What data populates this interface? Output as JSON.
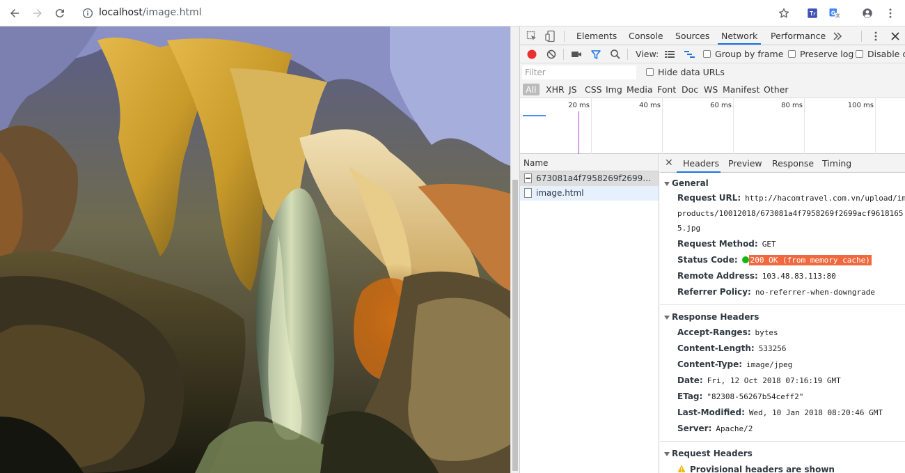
{
  "browser": {
    "url_host": "localhost",
    "url_path": "/image.html",
    "icons": [
      "back-icon",
      "forward-icon",
      "reload-icon",
      "info-icon",
      "star-icon",
      "translate-extension-icon",
      "google-translate-icon",
      "account-icon",
      "menu-icon"
    ]
  },
  "devtools": {
    "tabs": [
      "Elements",
      "Console",
      "Sources",
      "Network",
      "Performance"
    ],
    "active_tab": "Network",
    "netbar": {
      "view_label": "View:",
      "group_by_frame": "Group by frame",
      "preserve_log": "Preserve log",
      "disable_cache": "Disable cache"
    },
    "filter": {
      "placeholder": "Filter",
      "hide_data_urls": "Hide data URLs"
    },
    "types": [
      "All",
      "XHR",
      "JS",
      "CSS",
      "Img",
      "Media",
      "Font",
      "Doc",
      "WS",
      "Manifest",
      "Other"
    ],
    "active_type": "All",
    "overview_ticks": [
      "20 ms",
      "40 ms",
      "60 ms",
      "80 ms",
      "100 ms"
    ],
    "name_header": "Name",
    "requests": [
      {
        "name": "673081a4f7958269f2699acf9618165 5.jpg",
        "display": "673081a4f7958269f2699acf…"
      },
      {
        "name": "image.html",
        "display": "image.html"
      }
    ],
    "detail_tabs": [
      "Headers",
      "Preview",
      "Response",
      "Timing"
    ],
    "active_detail_tab": "Headers",
    "general": {
      "title": "General",
      "request_url_key": "Request URL:",
      "request_url_lines": [
        "http://hacomtravel.com.vn/upload/img/",
        "products/10012018/673081a4f7958269f2699acf9618165",
        "5.jpg"
      ],
      "request_method_key": "Request Method:",
      "request_method": "GET",
      "status_code_key": "Status Code:",
      "status_code": "200 OK (from memory cache)",
      "remote_address_key": "Remote Address:",
      "remote_address": "103.48.83.113:80",
      "referrer_policy_key": "Referrer Policy:",
      "referrer_policy": "no-referrer-when-downgrade"
    },
    "response_headers": {
      "title": "Response Headers",
      "rows": [
        {
          "k": "Accept-Ranges:",
          "v": "bytes"
        },
        {
          "k": "Content-Length:",
          "v": "533256"
        },
        {
          "k": "Content-Type:",
          "v": "image/jpeg"
        },
        {
          "k": "Date:",
          "v": "Fri, 12 Oct 2018 07:16:19 GMT"
        },
        {
          "k": "ETag:",
          "v": "\"82308-56267b54ceff2\""
        },
        {
          "k": "Last-Modified:",
          "v": "Wed, 10 Jan 2018 08:20:46 GMT"
        },
        {
          "k": "Server:",
          "v": "Apache/2"
        }
      ]
    },
    "request_headers": {
      "title": "Request Headers",
      "warning": "Provisional headers are shown"
    }
  },
  "colors": {
    "accent": "#1a73e8",
    "status_highlight": "#f0683e",
    "status_dot": "#12b812",
    "record": "#e8312f"
  }
}
